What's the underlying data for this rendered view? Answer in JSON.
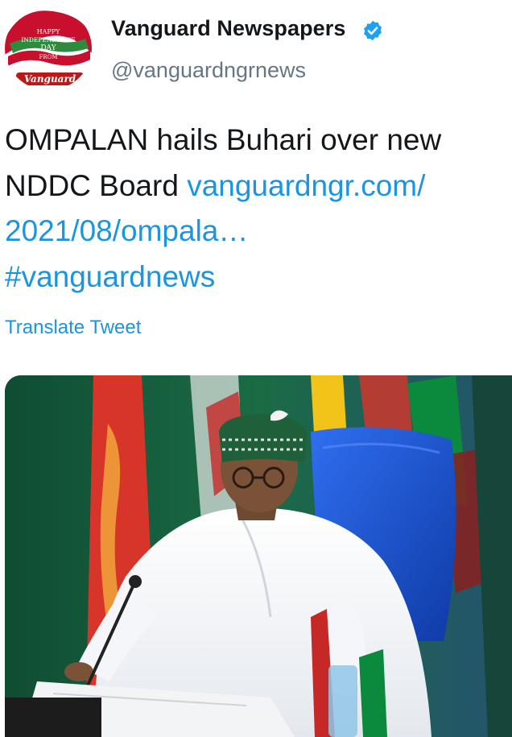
{
  "account": {
    "display_name": "Vanguard Newspapers",
    "handle": "@vanguardngrnews",
    "verified_icon": "verified-badge-icon",
    "avatar": {
      "line1": "HAPPY",
      "line2": "INDEPENDENCE",
      "line3": "DAY",
      "line4": "FROM",
      "brand": "Vanguard"
    }
  },
  "tweet": {
    "line1": "OMPALAN hails Buhari over new",
    "line2_text": "NDDC Board ",
    "link_part1": "vanguardngr.com/",
    "link_part2": "2021/08/ompala…",
    "hashtag": "#vanguardnews"
  },
  "actions": {
    "translate_label": "Translate Tweet"
  },
  "colors": {
    "link": "#1b95e0",
    "text": "#14171a",
    "secondary": "#657786",
    "verified": "#1da1f2"
  }
}
